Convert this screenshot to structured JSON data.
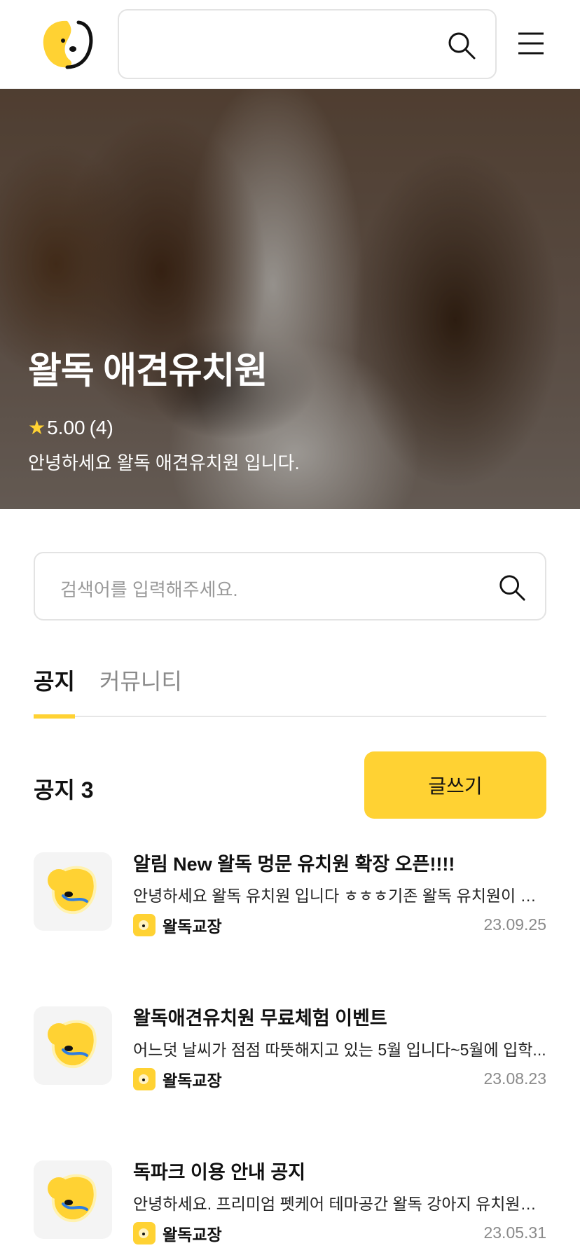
{
  "header": {
    "logo_icon": "dog-face-logo-icon",
    "search_icon": "search-icon",
    "menu_icon": "hamburger-menu-icon"
  },
  "hero": {
    "title": "왈독 애견유치원",
    "rating": "5.00",
    "review_count": "(4)",
    "description": "안녕하세요 왈독 애견유치원 입니다."
  },
  "search": {
    "placeholder": "검색어를 입력해주세요."
  },
  "tabs": [
    {
      "label": "공지",
      "active": true
    },
    {
      "label": "커뮤니티",
      "active": false
    }
  ],
  "section": {
    "title": "공지 3",
    "write_label": "글쓰기"
  },
  "posts": [
    {
      "title": "알림 New 왈독 멍문 유치원 확장 오픈!!!!",
      "excerpt": "안녕하세요 왈독 유치원 입니다 ㅎㅎㅎ기존 왈독 유치원이 이...",
      "author": "왈독교장",
      "date": "23.09.25"
    },
    {
      "title": "왈독애견유치원 무료체험 이벤트",
      "excerpt": "어느덧 날씨가 점점 따뜻해지고 있는 5월 입니다~5월에 입학...",
      "author": "왈독교장",
      "date": "23.08.23"
    },
    {
      "title": "독파크 이용 안내 공지",
      "excerpt": "안녕하세요. 프리미엄 펫케어 테마공간 왈독 강아지 유치원입...",
      "author": "왈독교장",
      "date": "23.05.31"
    }
  ],
  "colors": {
    "accent": "#ffd233",
    "text": "#111111",
    "muted": "#8a8a8a"
  }
}
